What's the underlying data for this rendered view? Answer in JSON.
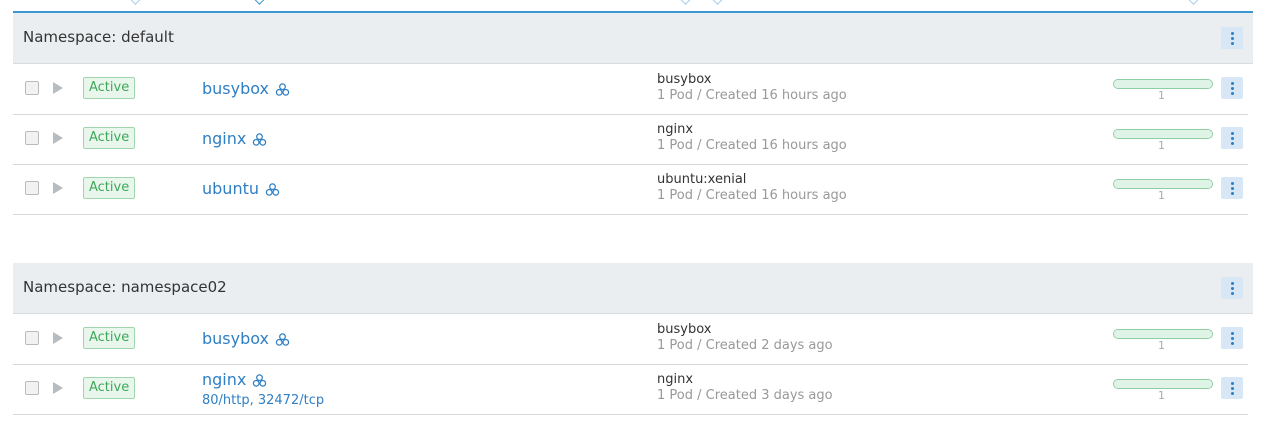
{
  "colors": {
    "accent": "#2f7fc4",
    "status_active": "#3ea85a",
    "header_bg": "#ebeef0"
  },
  "namespaces": [
    {
      "title": "Namespace: default",
      "workloads": [
        {
          "state": "Active",
          "name": "busybox",
          "image": "busybox",
          "meta": "1 Pod / Created 16 hours ago",
          "scale": "1",
          "icon": "service-icon"
        },
        {
          "state": "Active",
          "name": "nginx",
          "image": "nginx",
          "meta": "1 Pod / Created 16 hours ago",
          "scale": "1",
          "icon": "service-icon"
        },
        {
          "state": "Active",
          "name": "ubuntu",
          "image": "ubuntu:xenial",
          "meta": "1 Pod / Created 16 hours ago",
          "scale": "1",
          "icon": "service-icon"
        }
      ]
    },
    {
      "title": "Namespace: namespace02",
      "workloads": [
        {
          "state": "Active",
          "name": "busybox",
          "image": "busybox",
          "meta": "1 Pod / Created 2 days ago",
          "scale": "1",
          "icon": "service-icon"
        },
        {
          "state": "Active",
          "name": "nginx",
          "ports": "80/http, 32472/tcp",
          "image": "nginx",
          "meta": "1 Pod / Created 3 days ago",
          "scale": "1",
          "icon": "service-icon"
        }
      ]
    }
  ]
}
